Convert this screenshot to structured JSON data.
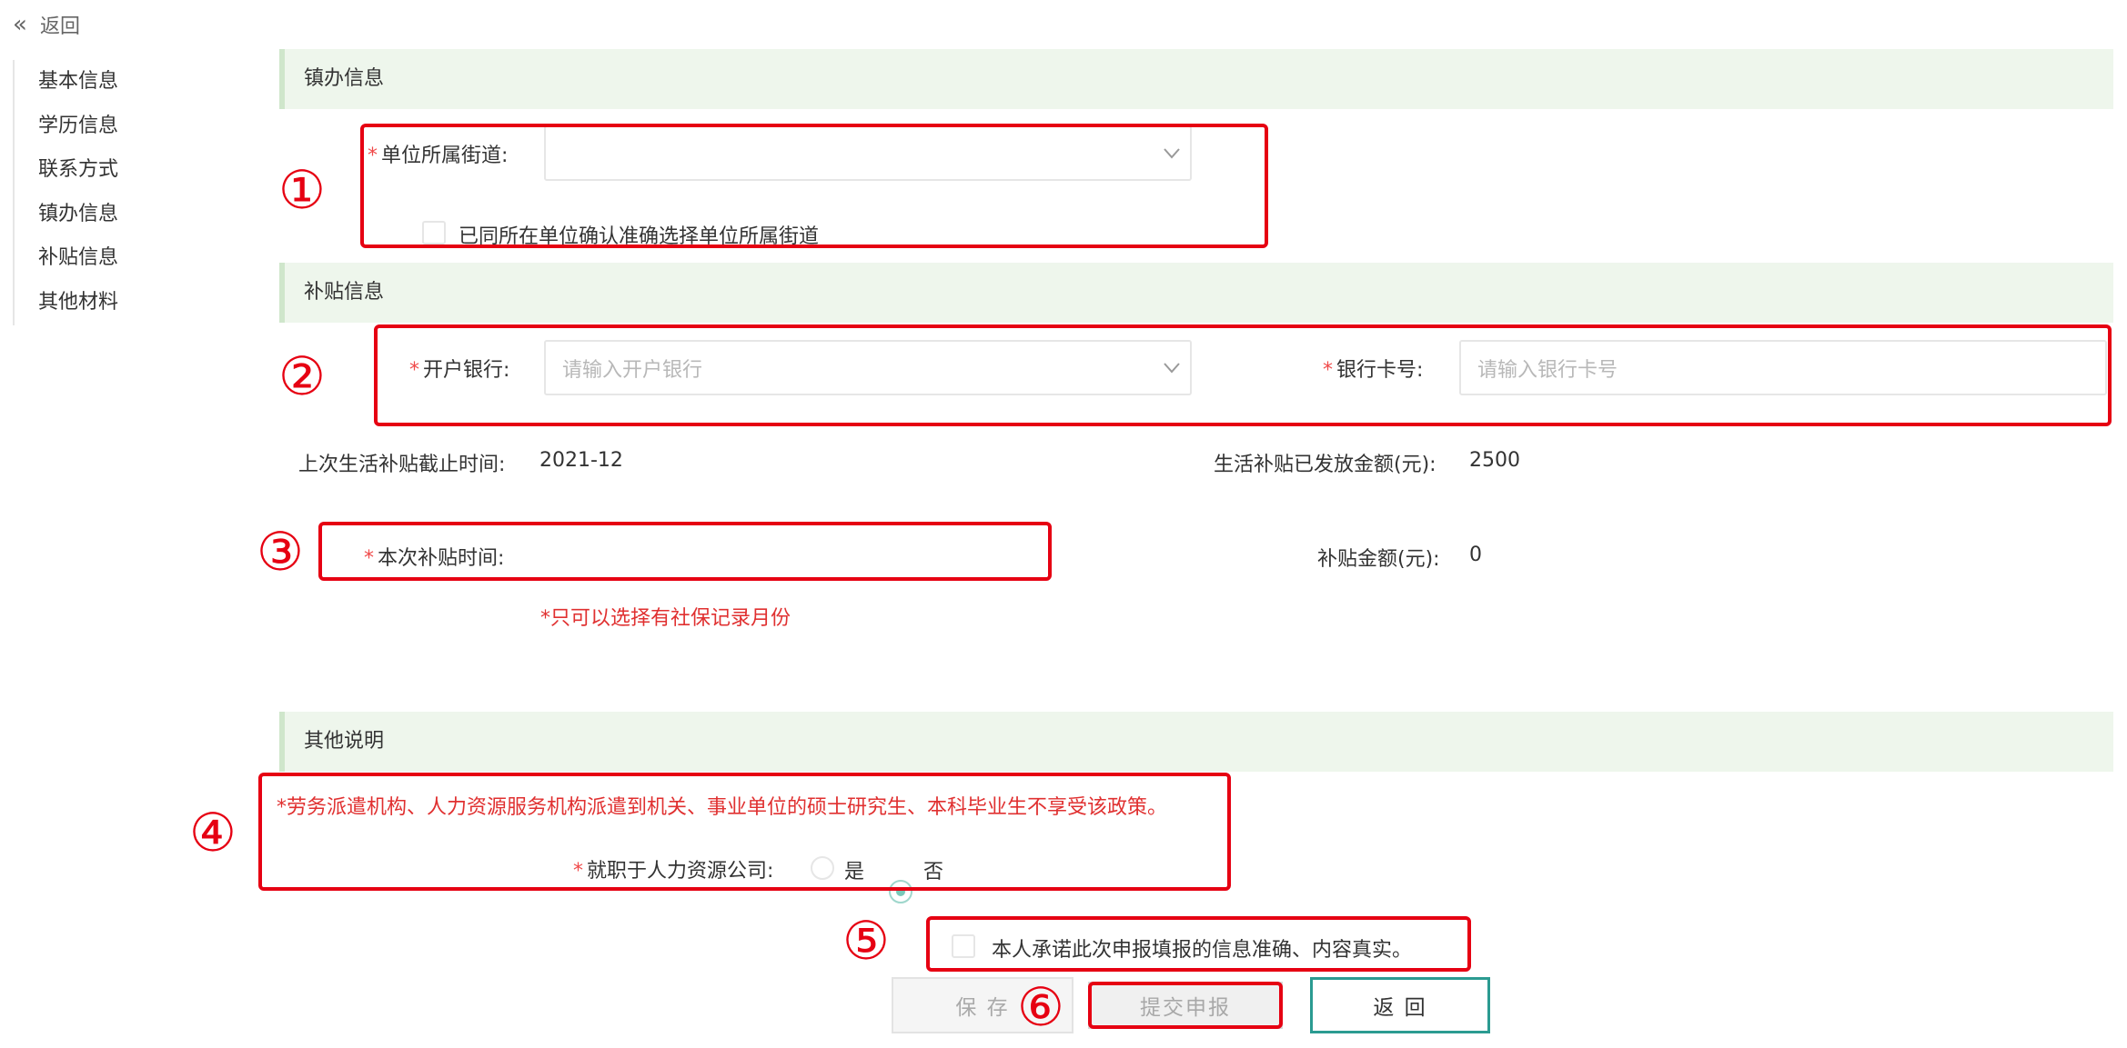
{
  "top_back": {
    "icon": "double-chevron-left-icon",
    "label": "返回"
  },
  "sidebar": {
    "items": [
      {
        "label": "基本信息"
      },
      {
        "label": "学历信息"
      },
      {
        "label": "联系方式"
      },
      {
        "label": "镇办信息"
      },
      {
        "label": "补贴信息"
      },
      {
        "label": "其他材料"
      }
    ]
  },
  "sections": {
    "town": {
      "title": "镇办信息",
      "street_label": "单位所属街道:",
      "street_value": "",
      "confirm_checkbox_label": "已同所在单位确认准确选择单位所属街道"
    },
    "subsidy": {
      "title": "补贴信息",
      "bank_label": "开户银行:",
      "bank_placeholder": "请输入开户银行",
      "card_label": "银行卡号:",
      "card_placeholder": "请输入银行卡号",
      "last_end_label": "上次生活补贴截止时间:",
      "last_end_value": "2021-12",
      "paid_label": "生活补贴已发放金额(元):",
      "paid_value": "2500",
      "this_time_label": "本次补贴时间:",
      "amount_label": "补贴金额(元):",
      "amount_value": "0",
      "month_note": "*只可以选择有社保记录月份"
    },
    "other": {
      "title": "其他说明",
      "policy_note": "*劳务派遣机构、人力资源服务机构派遣到机关、事业单位的硕士研究生、本科毕业生不享受该政策。",
      "hr_company_label": "就职于人力资源公司:",
      "option_yes": "是",
      "option_no": "否",
      "selected": "否"
    }
  },
  "commitment_label": "本人承诺此次申报填报的信息准确、内容真实。",
  "buttons": {
    "save": "保 存",
    "submit": "提交申报",
    "back": "返 回"
  },
  "annotations": [
    "①",
    "②",
    "③",
    "④",
    "⑤",
    "⑥"
  ],
  "colors": {
    "annotation_red": "#e60012",
    "section_bg": "#eef6ec",
    "required_star": "#f04a4a",
    "note_red": "#e03030",
    "teal": "#2b9b91"
  }
}
